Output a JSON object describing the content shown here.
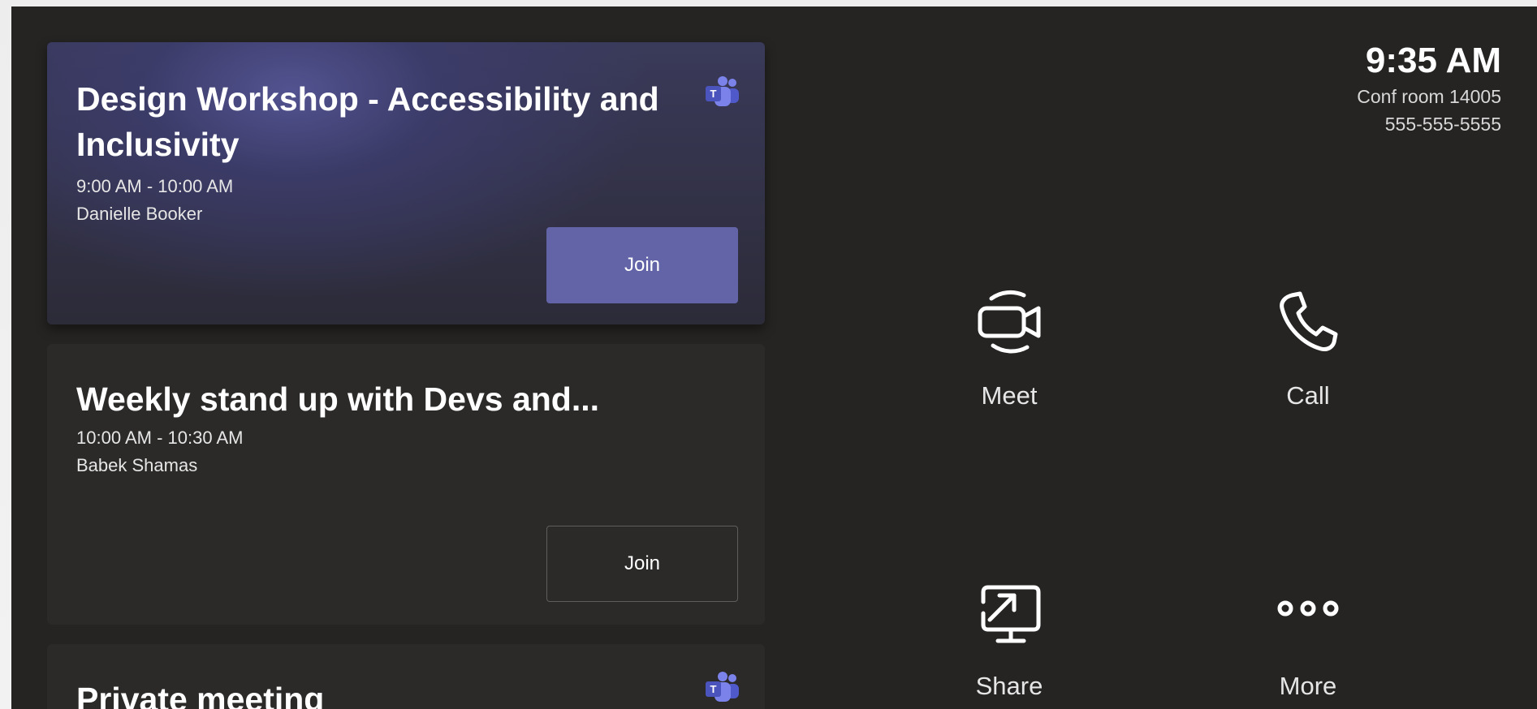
{
  "colors": {
    "screen_bg": "#252423",
    "card_bg": "#2b2a29",
    "brand_purple": "#6264a7",
    "text_primary": "#ffffff",
    "text_secondary": "#e6e6e6"
  },
  "header": {
    "time": "9:35 AM",
    "room": "Conf room 14005",
    "phone": "555-555-5555"
  },
  "meetings": [
    {
      "title": "Design Workshop - Accessibility and Inclusivity",
      "time": "9:00 AM - 10:00 AM",
      "organizer": "Danielle Booker",
      "join_label": "Join",
      "icon": "teams-logo-icon",
      "active": true
    },
    {
      "title": "Weekly stand up with Devs and...",
      "time": "10:00 AM - 10:30 AM",
      "organizer": "Babek Shamas",
      "join_label": "Join",
      "active": false
    },
    {
      "title": "Private meeting",
      "icon": "teams-logo-icon"
    }
  ],
  "actions": [
    {
      "label": "Meet",
      "icon": "video-camera-icon"
    },
    {
      "label": "Call",
      "icon": "phone-icon"
    },
    {
      "label": "Share",
      "icon": "screen-share-icon"
    },
    {
      "label": "More",
      "icon": "more-dots-icon"
    }
  ]
}
